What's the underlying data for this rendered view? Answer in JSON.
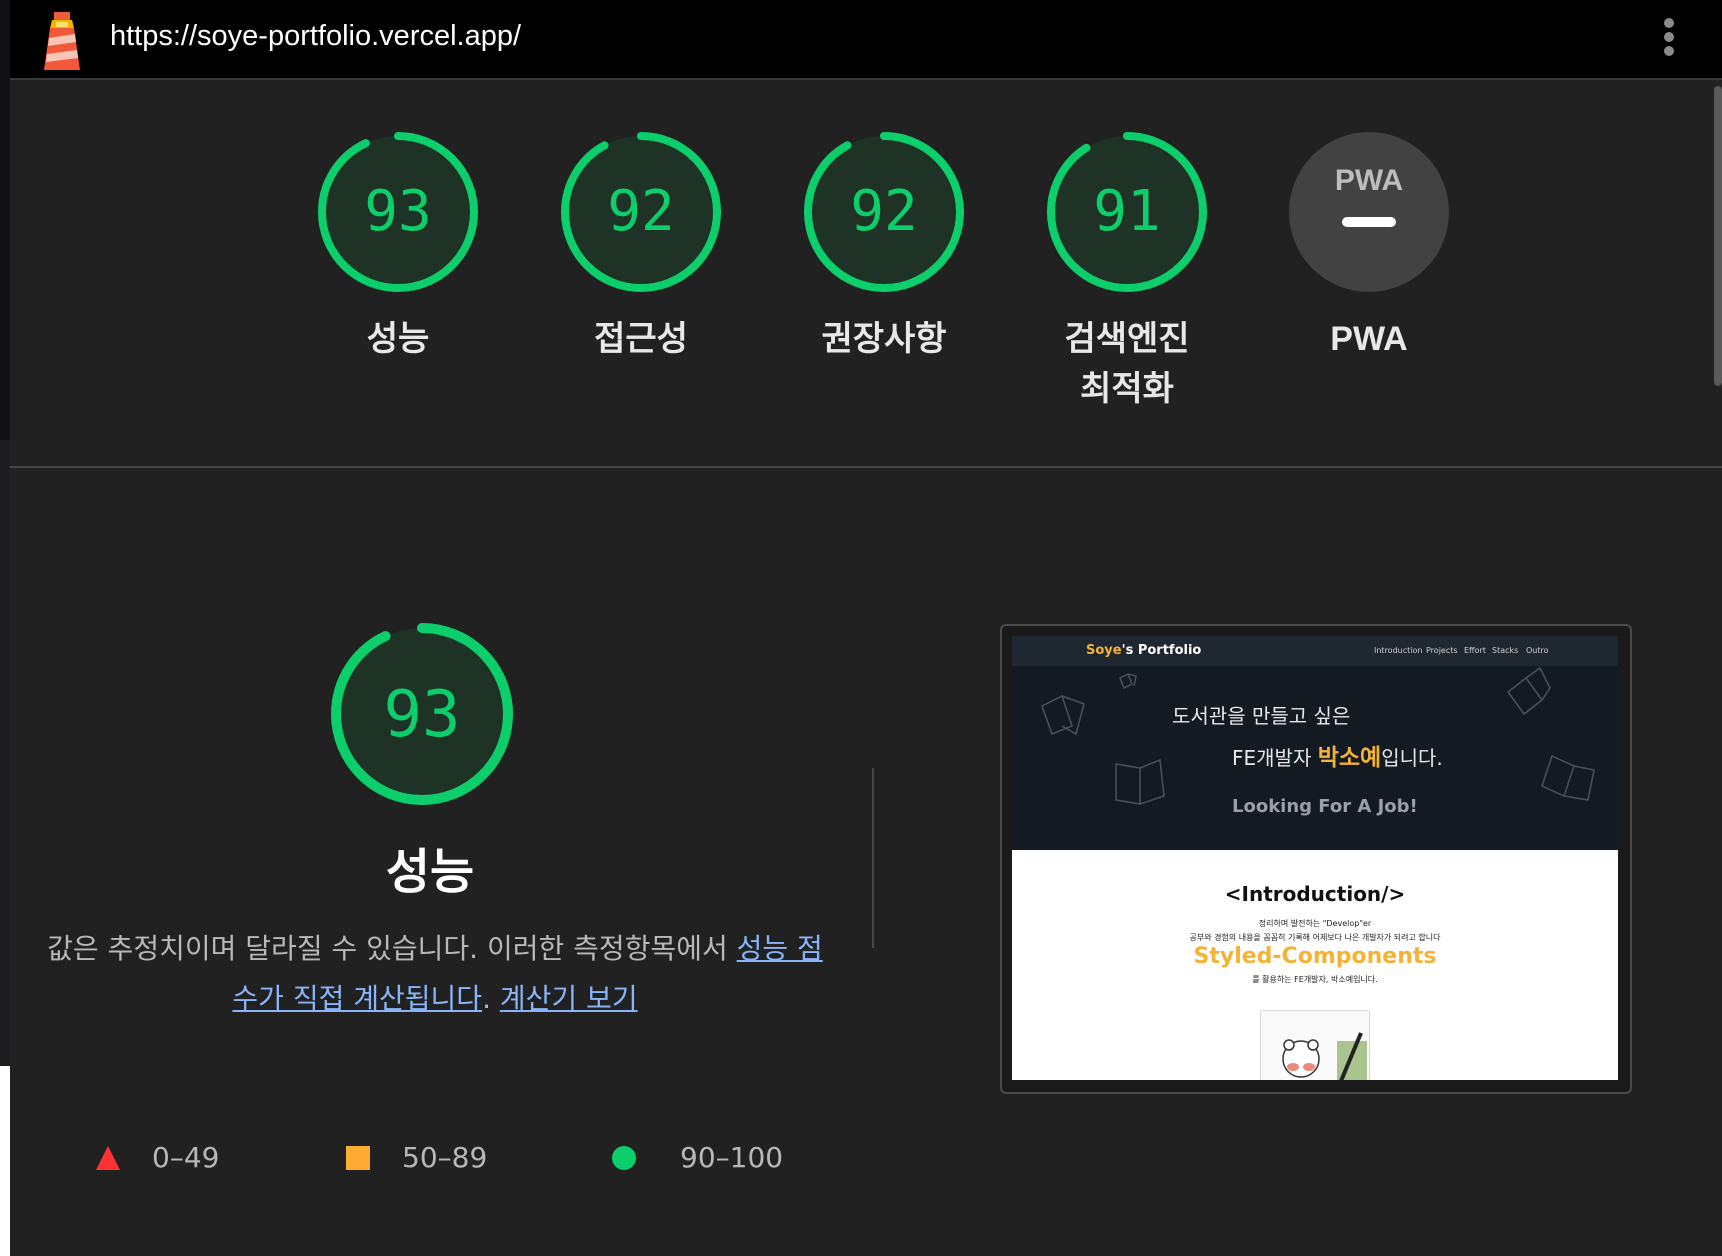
{
  "topbar": {
    "url": "https://soye-portfolio.vercel.app/",
    "menu_icon": "kebab-menu-icon",
    "logo_icon": "lighthouse-icon"
  },
  "gauges": [
    {
      "score": "93",
      "label": "성능"
    },
    {
      "score": "92",
      "label": "접근성"
    },
    {
      "score": "92",
      "label": "권장사항"
    },
    {
      "score": "91",
      "label": "검색엔진 최적화",
      "label_line1": "검색엔진",
      "label_line2": "최적화"
    },
    {
      "score": null,
      "label": "PWA",
      "badge": "PWA"
    }
  ],
  "performance": {
    "score": "93",
    "title": "성능",
    "description_prefix": "값은 추정치이며 달라질 수 있습니다. 이러한 측정항목에서 ",
    "link1": "성능 점수가 직접 계산됩니다",
    "link1_line1": "성능 점",
    "link1_line2": "수가 직접 계산됩니다",
    "separator": ". ",
    "link2": "계산기 보기"
  },
  "legend": [
    {
      "range": "0–49",
      "shape": "triangle",
      "color": "#ff3333"
    },
    {
      "range": "50–89",
      "shape": "square",
      "color": "#ffaa33"
    },
    {
      "range": "90–100",
      "shape": "circle",
      "color": "#0cce6b"
    }
  ],
  "colors": {
    "pass": "#0cce6b",
    "pass_bg": "#1e3326",
    "panel_bg": "#212121",
    "link": "#89b4f8"
  },
  "screenshot": {
    "brand_yellow": "Soye",
    "brand_rest": "'s Portfolio",
    "nav": [
      "Introduction",
      "Projects",
      "Effort",
      "Stacks",
      "Outro"
    ],
    "hero_line1": "도서관을 만들고 싶은",
    "hero_line2_prefix": "FE개발자 ",
    "hero_line2_name": "박소예",
    "hero_line2_suffix": "입니다.",
    "hero_line3": "Looking For A Job!",
    "intro_title": "<Introduction/>",
    "intro_sub1": "정리하며 발전하는 \"Develop\"er",
    "intro_sub2": "공부와 경험의 내용을 꼼꼼히 기록해 어제보다 나은 개발자가 되려고 합니다",
    "intro_big": "Styled-Components",
    "intro_sub3": "를 활용하는 FE개발자, 박소예입니다."
  }
}
